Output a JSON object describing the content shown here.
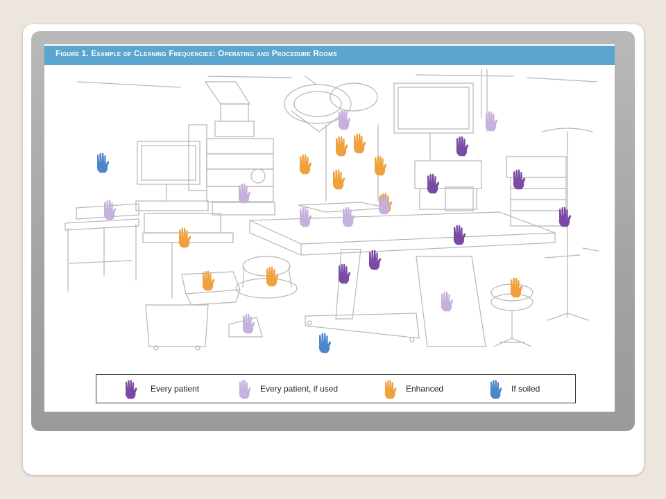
{
  "figure": {
    "title": "Figure 1. Example of Cleaning Frequencies: Operating and Procedure Rooms"
  },
  "colors": {
    "every_patient": "#7a4aa5",
    "every_patient_if_used": "#c6b1dd",
    "enhanced": "#f0a03c",
    "if_soiled": "#4d86c9",
    "title_bar": "#5aa6cf"
  },
  "legend": [
    {
      "category": "every_patient",
      "label": "Every patient",
      "icon": "hand-icon"
    },
    {
      "category": "every_patient_if_used",
      "label": "Every patient, if used",
      "icon": "hand-icon"
    },
    {
      "category": "enhanced",
      "label": "Enhanced",
      "icon": "hand-icon"
    },
    {
      "category": "if_soiled",
      "label": "If soiled",
      "icon": "hand-icon"
    }
  ],
  "hands": [
    {
      "category": "if_soiled",
      "surface": "wall"
    },
    {
      "category": "every_patient_if_used",
      "surface": "side-table"
    },
    {
      "category": "enhanced",
      "surface": "keyboard-tray"
    },
    {
      "category": "every_patient_if_used",
      "surface": "monitor-cart"
    },
    {
      "category": "every_patient_if_used",
      "surface": "surgical-light"
    },
    {
      "category": "enhanced",
      "surface": "light-handle"
    },
    {
      "category": "enhanced",
      "surface": "light-handle"
    },
    {
      "category": "enhanced",
      "surface": "light-handle"
    },
    {
      "category": "enhanced",
      "surface": "light-arm"
    },
    {
      "category": "enhanced",
      "surface": "light-arm"
    },
    {
      "category": "enhanced",
      "surface": "light-arm"
    },
    {
      "category": "every_patient_if_used",
      "surface": "boom-monitor"
    },
    {
      "category": "every_patient",
      "surface": "anesthesia-machine"
    },
    {
      "category": "every_patient",
      "surface": "anesthesia-machine"
    },
    {
      "category": "every_patient",
      "surface": "anesthesia-cart"
    },
    {
      "category": "every_patient",
      "surface": "iv-pole"
    },
    {
      "category": "every_patient_if_used",
      "surface": "table-armboard"
    },
    {
      "category": "every_patient_if_used",
      "surface": "table-armboard"
    },
    {
      "category": "every_patient_if_used",
      "surface": "table-head"
    },
    {
      "category": "every_patient",
      "surface": "or-table"
    },
    {
      "category": "every_patient",
      "surface": "table-column"
    },
    {
      "category": "every_patient",
      "surface": "table-column"
    },
    {
      "category": "every_patient_if_used",
      "surface": "table-base"
    },
    {
      "category": "enhanced",
      "surface": "stool"
    },
    {
      "category": "enhanced",
      "surface": "kick-bucket"
    },
    {
      "category": "enhanced",
      "surface": "step-stool"
    },
    {
      "category": "every_patient_if_used",
      "surface": "floor-bin"
    },
    {
      "category": "if_soiled",
      "surface": "floor"
    }
  ]
}
